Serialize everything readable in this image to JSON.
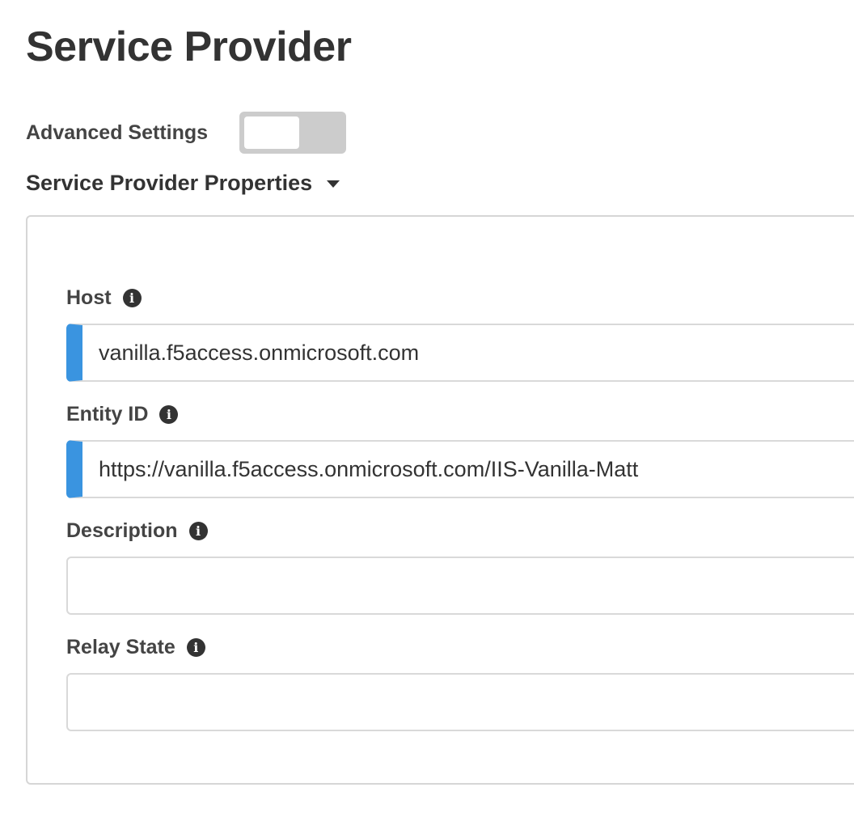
{
  "page": {
    "title": "Service Provider"
  },
  "advanced_settings": {
    "label": "Advanced Settings",
    "enabled": false
  },
  "section": {
    "title": "Service Provider Properties",
    "expanded": true
  },
  "fields": [
    {
      "label": "Host",
      "value": "vanilla.f5access.onmicrosoft.com",
      "required": true
    },
    {
      "label": "Entity ID",
      "value": "https://vanilla.f5access.onmicrosoft.com/IIS-Vanilla-Matt",
      "required": true
    },
    {
      "label": "Description",
      "value": "",
      "required": false
    },
    {
      "label": "Relay State",
      "value": "",
      "required": false
    }
  ],
  "icons": {
    "info": "info-circle-icon",
    "caret": "caret-down-icon"
  },
  "colors": {
    "required_marker": "#3a94e0",
    "toggle_off": "#cccccc",
    "text": "#333333"
  }
}
